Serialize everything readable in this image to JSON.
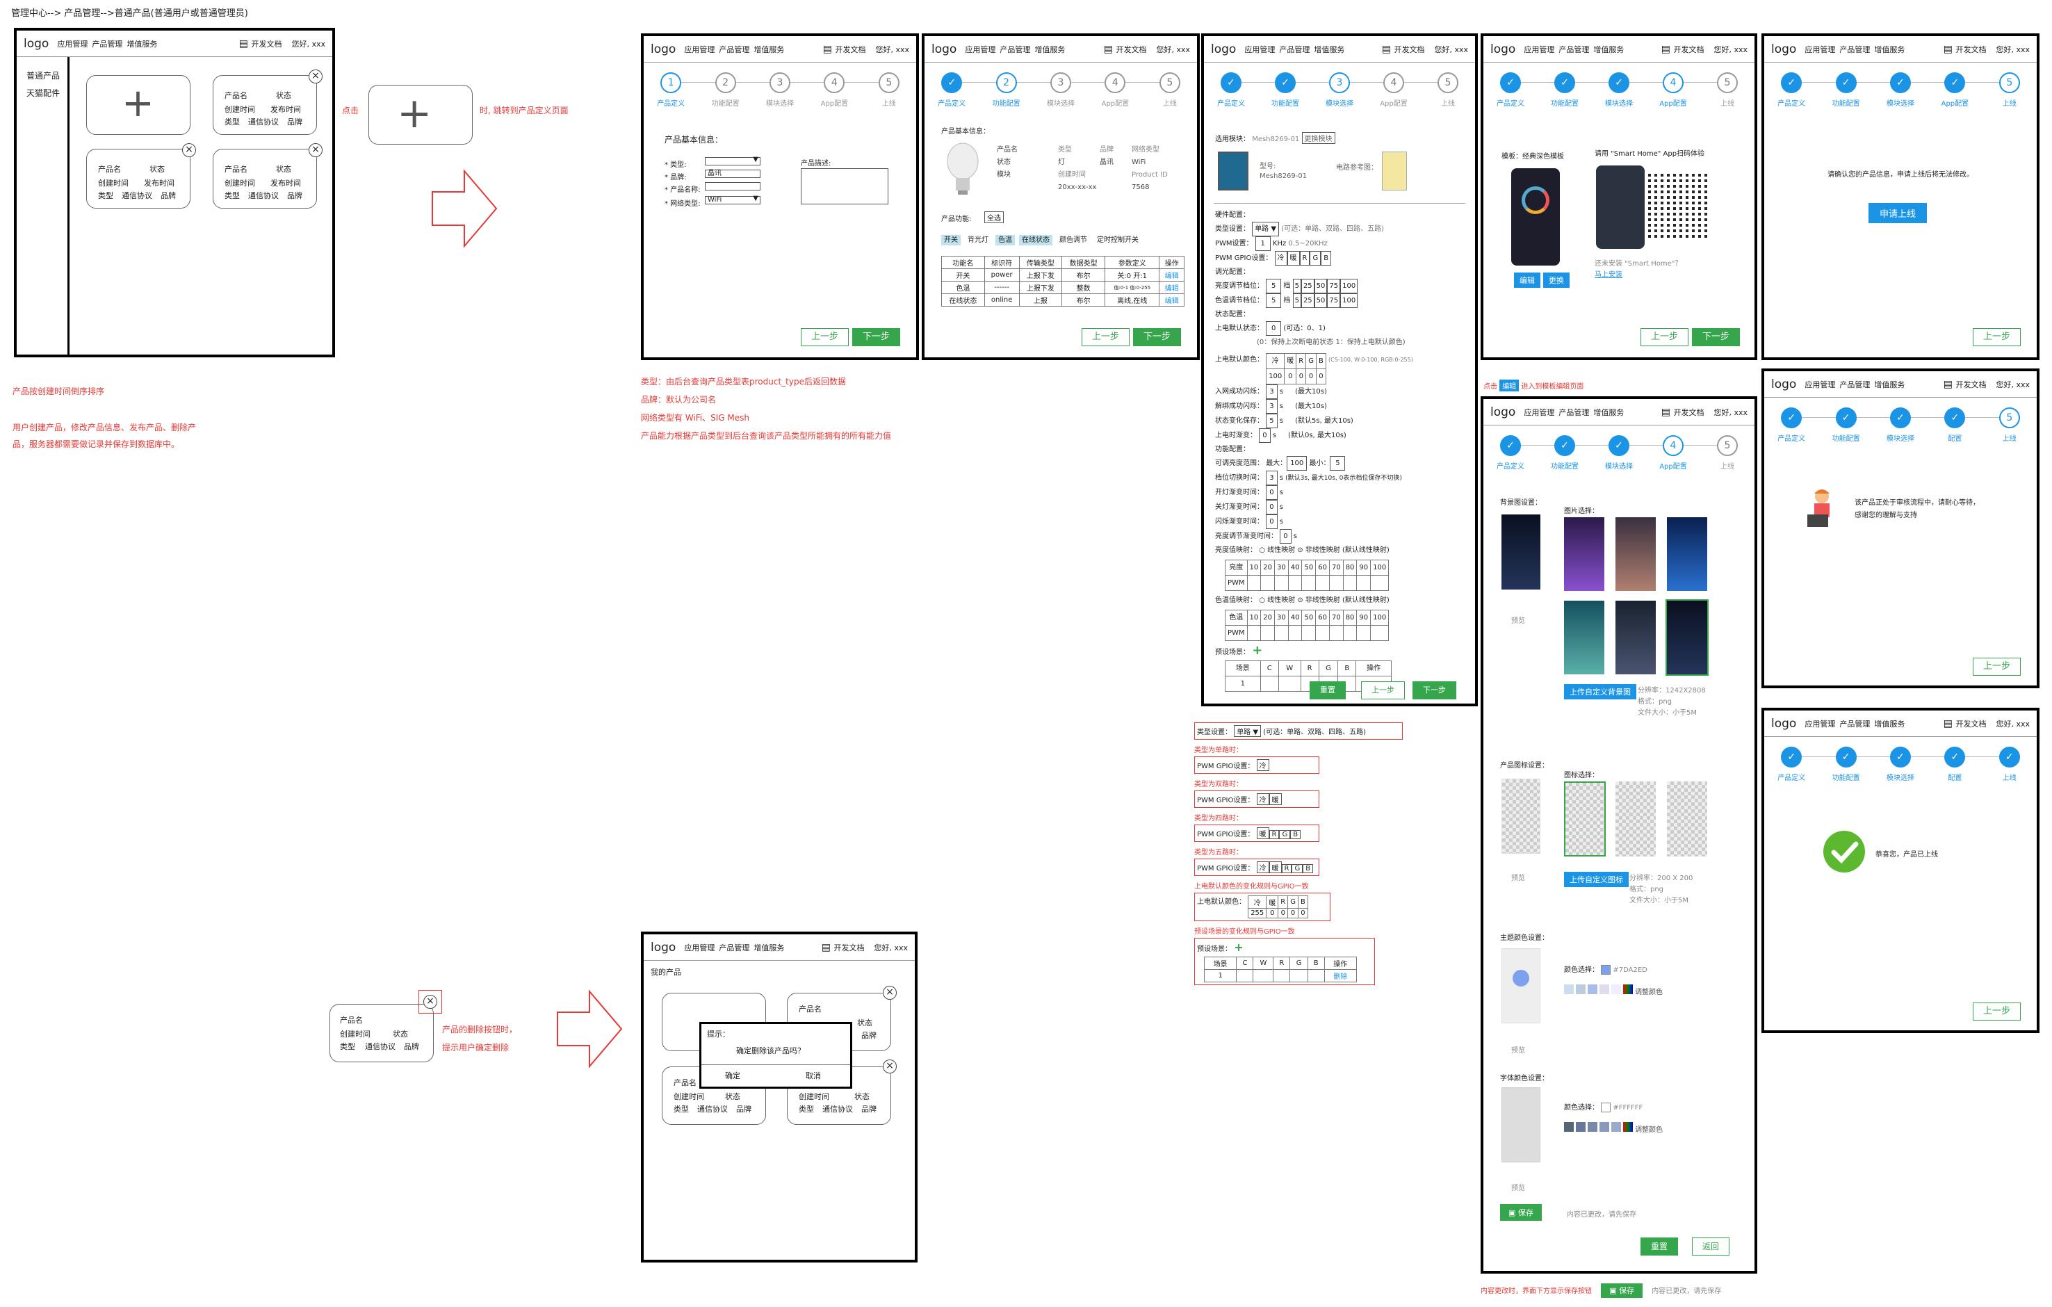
{
  "breadcrumb": "管理中心--> 产品管理-->普通产品(普通用户或普通管理员)",
  "header": {
    "logo": "logo",
    "nav1": "应用管理",
    "nav2": "产品管理",
    "nav3": "增值服务",
    "doc": "开发文档",
    "hello": "您好, xxx"
  },
  "sidebar": {
    "item1": "普通产品",
    "item2": "天猫配件"
  },
  "card": {
    "name": "产品名",
    "status": "状态",
    "created": "创建时间",
    "published": "发布时间",
    "type": "类型",
    "protocol": "通信协议",
    "brand": "品牌"
  },
  "notes": {
    "click": "点击",
    "jump": "时, 跳转到产品定义页面",
    "sort": "产品按创建时间倒序排序",
    "ops": "用户创建产品，修改产品信息、发布产品、删除产",
    "ops2": "品，服务器都需要做记录并保存到数据库中。",
    "del1": "产品的删除按钮时，",
    "del2": "提示用户确定删除",
    "type": "类型：由后台查询产品类型表product_type后返回数据",
    "brand": "品牌：默认为公司名",
    "net": "网络类型有 WiFi、SIG Mesh",
    "func": "产品能力根据产品类型到后台查询该产品类型所能拥有的所有能力值",
    "edit_pre": "点击",
    "edit_btn": "编辑",
    "edit_post": "进入到模板编辑页面",
    "save_note": "内容更改时，界面下方显示保存按钮",
    "unsaved": "内容已更改，请先保存"
  },
  "steps": [
    "产品定义",
    "功能配置",
    "模块选择",
    "App配置",
    "上线"
  ],
  "steps_alt": [
    "产品定义",
    "功能配置",
    "模块选择",
    "配置",
    "上线"
  ],
  "buttons": {
    "prev": "上一步",
    "next": "下一步",
    "reset": "重置",
    "back": "返回",
    "save": "保存",
    "apply": "申请上线",
    "edit": "编辑",
    "change": "更换",
    "confirm": "确定",
    "cancel": "取消",
    "upload_bg": "上传自定义背景图",
    "upload_icon": "上传自定义图标"
  },
  "s1": {
    "title": "产品基本信息：",
    "type": "* 类型:",
    "brand": "* 品牌:",
    "brand_val": "晶讯",
    "name": "* 产品名称:",
    "net": "* 网络类型:",
    "net_val": "WiFi",
    "desc": "产品描述:"
  },
  "s2": {
    "title": "产品基本信息：",
    "k1": "产品名",
    "v1": "类型",
    "v2": "品牌",
    "v3": "网络类型",
    "k2": "状态",
    "w1": "灯",
    "w2": "晶讯",
    "w3": "WiFi",
    "k3": "模块",
    "u1": "创建时间",
    "u2": "Product ID",
    "d1": "20xx-xx-xx",
    "d2": "7568",
    "func": "产品功能:",
    "all": "全选",
    "tags": [
      "开关",
      "背光灯",
      "色温",
      "在线状态",
      "颜色调节",
      "定时控制开关"
    ],
    "th": [
      "功能名",
      "标识符",
      "传输类型",
      "数据类型",
      "参数定义",
      "操作"
    ],
    "rows": [
      [
        "开关",
        "power",
        "上报下发",
        "布尔",
        "关:0 开:1",
        "编辑"
      ],
      [
        "色温",
        "------",
        "上报下发",
        "整数",
        "值:0-1 值:0-255",
        "编辑"
      ],
      [
        "在线状态",
        "online",
        "上报",
        "布尔",
        "离线,在线",
        "编辑"
      ]
    ]
  },
  "s3": {
    "module_lbl": "选用模块：",
    "module": "Mesh8269-01",
    "change": "更换模块",
    "model_lbl": "型号:",
    "model": "Mesh8269-01",
    "ref": "电路参考图：",
    "hw": "硬件配置：",
    "type_lbl": "类型设置：",
    "type_val": "单路",
    "type_opts": "(可选：单路、双路、四路、五路)",
    "pwm": "PWM设置：",
    "pwm_val": "1",
    "khz": "KHz",
    "khz_rng": "0.5~20KHz",
    "gpio": "PWM GPIO设置：",
    "light": "调光配置：",
    "bright": "亮度调节档位：",
    "cct": "色温调节档位：",
    "lv": "5",
    "lvs": [
      "5",
      "25",
      "50",
      "75",
      "100"
    ],
    "state": "状态配置：",
    "power_on": "上电默认状态：",
    "power_val": "0",
    "power_opt": "(可选：0、1)",
    "power_note": "(0：保持上次断电前状态 1：保持上电默认颜色)",
    "color": "上电默认颜色：",
    "rng": "(CS-100, W:0-100, RGB:0-255)",
    "net_ok": "入网成功闪烁：",
    "net_fail": "解绑成功闪烁：",
    "state_save": "状态变化保存：",
    "on_delay": "上电时渐变：",
    "ms": "(最大10s)",
    "ms2": "(默认5s, 最大10s)",
    "ms3": "(默认0s, 最大10s)",
    "func": "功能配置：",
    "range": "可调亮度范围：",
    "max": "最大：",
    "max_v": "100",
    "min": "最小：",
    "min_v": "5",
    "switch": "档位切换时间：",
    "sw_note": "(默认3s, 最大10s, 0表示档位保存不切换)",
    "open": "开灯渐变时间：",
    "close": "关灯渐变时间：",
    "blink": "闪烁渐变时间：",
    "shift": "亮度调节渐变时间：",
    "bcurve": "亮度值映射：",
    "ccurve": "色温值映射：",
    "lin": "○ 线性映射",
    "nonlin": "⊙ 非线性映射",
    "def": "(默认线性映射)",
    "curve_cols": [
      "10",
      "20",
      "30",
      "40",
      "50",
      "60",
      "70",
      "80",
      "90",
      "100"
    ],
    "bright_lbl": "亮度",
    "cct_lbl": "色温",
    "pwm_lbl": "PWM",
    "preset": "预设场景：",
    "scene_cols": [
      "场景",
      "C",
      "W",
      "R",
      "G",
      "B",
      "操作"
    ],
    "delete": "删除",
    "type1": "类型为单路时：",
    "type2": "类型为双路时：",
    "type4": "类型为四路时：",
    "type5": "类型为五路时：",
    "rule": "上电默认颜色的变化规则与GPIO一致",
    "rule2": "预设场景的变化规则与GPIO一致"
  },
  "s4": {
    "mode": "模板：经典深色模板",
    "scan": "请用 \"Smart Home\" App扫码体验",
    "install": "还未安装 \"Smart Home\"？",
    "download": "马上安装",
    "bg": "背景图设置：",
    "pick": "图片选择：",
    "preview": "预览",
    "res_bg": "分辨率：1242X2808",
    "fmt": "格式：png",
    "size": "文件大小：小于5M",
    "icon": "产品图标设置：",
    "pick_icon": "图标选择：",
    "res_icon": "分辨率：200 X 200",
    "theme": "主题颜色设置：",
    "color_pick": "颜色选择：",
    "theme_hex": "#7DA2ED",
    "adjust": "调整颜色",
    "font": "字体颜色设置：",
    "font_hex": "#FFFFFF"
  },
  "s5": {
    "confirm": "请确认您的产品信息，申请上线后将无法修改。",
    "review": "该产品正处于审核流程中，请耐心等待，",
    "thanks": "感谢您的理解与支持",
    "done": "恭喜您，产品已上线"
  },
  "dialog": {
    "my": "我的产品",
    "tip": "提示：",
    "msg": "确定删除该产品吗？"
  },
  "colors": {
    "blue": "#1b94e6",
    "green": "#35a64b",
    "red": "#e53935",
    "theme": "#7DA2ED"
  }
}
